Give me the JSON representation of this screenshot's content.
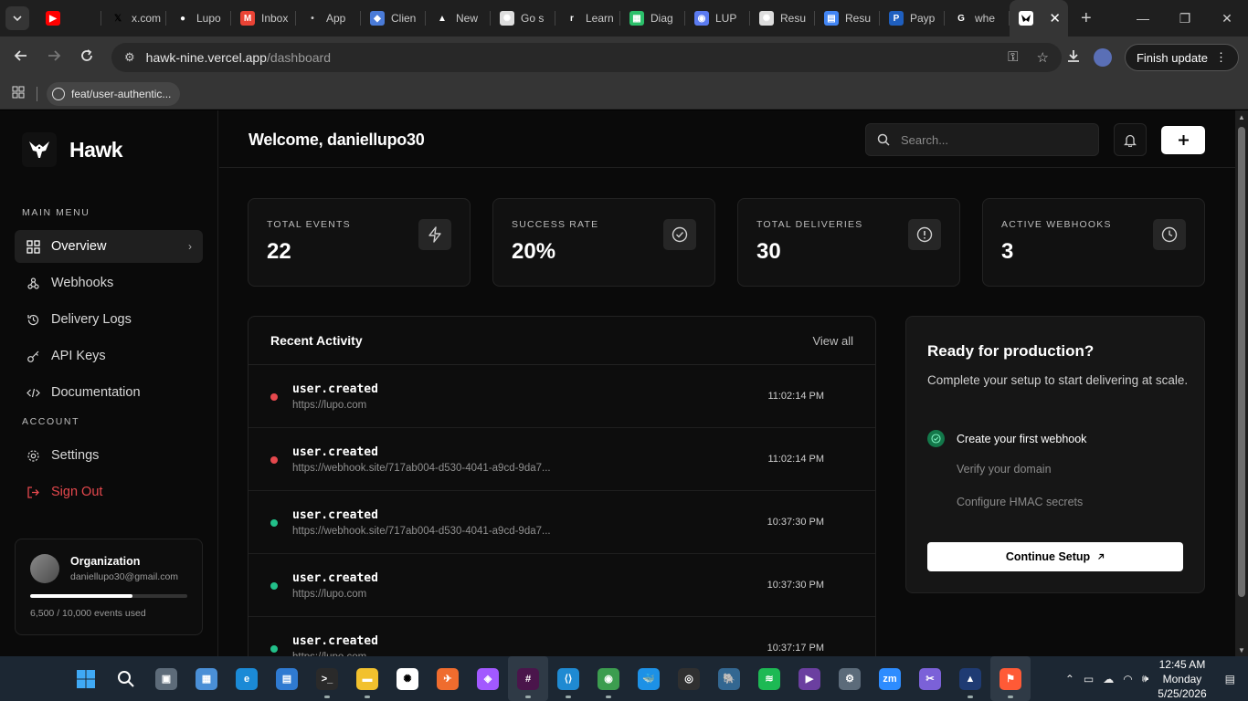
{
  "browser": {
    "tabs": [
      {
        "label": "",
        "icon": "youtube-icon",
        "color": "#ff0000"
      },
      {
        "label": "x.com",
        "icon": "x-icon",
        "color": "#000000"
      },
      {
        "label": "Lupo",
        "icon": "github-icon",
        "color": "#ffffff"
      },
      {
        "label": "Inbox",
        "icon": "gmail-icon",
        "color": "#ea4335"
      },
      {
        "label": "App",
        "icon": "apple-icon",
        "color": "#cccccc"
      },
      {
        "label": "Clien",
        "icon": "shield-icon",
        "color": "#4a7bd8"
      },
      {
        "label": "New",
        "icon": "vercel-icon",
        "color": "#ffffff"
      },
      {
        "label": "Go s",
        "icon": "openai-icon",
        "color": "#dddddd"
      },
      {
        "label": "Learn",
        "icon": "r-icon",
        "color": "#ffffff"
      },
      {
        "label": "Diag",
        "icon": "diagram-icon",
        "color": "#2bbf6a"
      },
      {
        "label": "LUP",
        "icon": "circle-icon",
        "color": "#5b7bf0"
      },
      {
        "label": "Resu",
        "icon": "openai-icon",
        "color": "#dddddd"
      },
      {
        "label": "Resu",
        "icon": "docs-icon",
        "color": "#4285f4"
      },
      {
        "label": "Payp",
        "icon": "paypal-icon",
        "color": "#1f5fbf"
      },
      {
        "label": "whe",
        "icon": "google-icon",
        "color": "#ffffff"
      }
    ],
    "active_tab_icon": "hawk-icon",
    "url_host": "hawk-nine.vercel.app",
    "url_path": "/dashboard",
    "finish_update": "Finish update",
    "bookmark": "feat/user-authentic..."
  },
  "app": {
    "brand": "Hawk",
    "main_menu_label": "MAIN MENU",
    "account_label": "ACCOUNT",
    "nav": [
      {
        "label": "Overview",
        "icon": "grid-icon",
        "active": true
      },
      {
        "label": "Webhooks",
        "icon": "webhook-icon"
      },
      {
        "label": "Delivery Logs",
        "icon": "history-icon"
      },
      {
        "label": "API Keys",
        "icon": "key-icon"
      },
      {
        "label": "Documentation",
        "icon": "code-icon"
      }
    ],
    "account_nav": [
      {
        "label": "Settings",
        "icon": "gear-icon"
      },
      {
        "label": "Sign Out",
        "icon": "logout-icon",
        "danger": true
      }
    ],
    "org": {
      "name": "Organization",
      "email": "daniellupo30@gmail.com",
      "usage_text": "6,500 / 10,000 events used",
      "usage_fraction": 0.65
    },
    "welcome": "Welcome, daniellupo30",
    "search_placeholder": "Search...",
    "stats": [
      {
        "label": "TOTAL EVENTS",
        "value": "22",
        "icon": "bolt-icon"
      },
      {
        "label": "SUCCESS RATE",
        "value": "20%",
        "icon": "check-circle-icon"
      },
      {
        "label": "TOTAL DELIVERIES",
        "value": "30",
        "icon": "alert-circle-icon"
      },
      {
        "label": "ACTIVE WEBHOOKS",
        "value": "3",
        "icon": "clock-icon"
      }
    ],
    "activity": {
      "title": "Recent Activity",
      "view_all": "View all",
      "rows": [
        {
          "event": "user.created",
          "url": "https://lupo.com",
          "time": "11:02:14 PM",
          "status": "failed"
        },
        {
          "event": "user.created",
          "url": "https://webhook.site/717ab004-d530-4041-a9cd-9da7...",
          "time": "11:02:14 PM",
          "status": "failed"
        },
        {
          "event": "user.created",
          "url": "https://webhook.site/717ab004-d530-4041-a9cd-9da7...",
          "time": "10:37:30 PM",
          "status": "success"
        },
        {
          "event": "user.created",
          "url": "https://lupo.com",
          "time": "10:37:30 PM",
          "status": "success"
        },
        {
          "event": "user.created",
          "url": "https://lupo.com",
          "time": "10:37:17 PM",
          "status": "success"
        }
      ]
    },
    "production": {
      "title": "Ready for production?",
      "description": "Complete your setup to start delivering at scale.",
      "steps": [
        {
          "label": "Create your first webhook",
          "done": true
        },
        {
          "label": "Verify your domain",
          "done": false
        },
        {
          "label": "Configure HMAC secrets",
          "done": false
        }
      ],
      "cta": "Continue Setup"
    },
    "colors": {
      "failed": "#e5484d",
      "success": "#22c08a",
      "danger": "#e5484d"
    }
  },
  "taskbar": {
    "time": "12:45 AM",
    "day": "Monday",
    "date": "5/25/2026"
  }
}
